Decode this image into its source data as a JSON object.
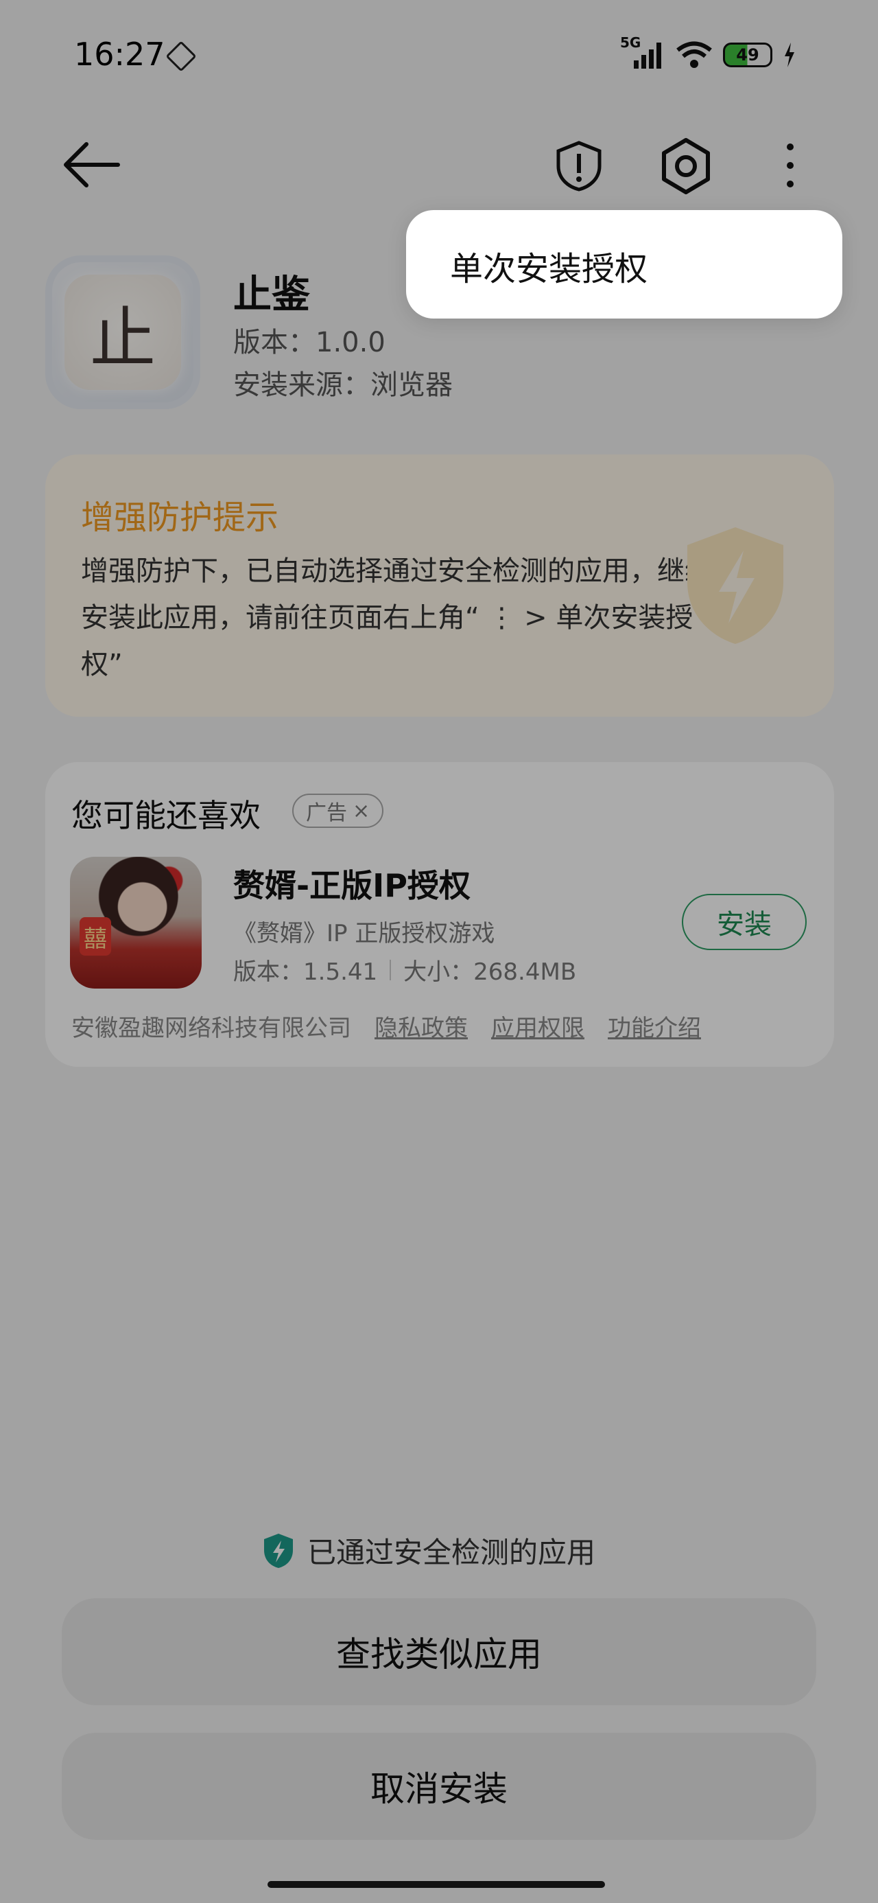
{
  "status_bar": {
    "time": "16:27",
    "network": "5G",
    "battery": "49"
  },
  "app": {
    "icon_char": "止",
    "name": "止鉴",
    "version": "版本：1.0.0",
    "source": "安装来源：浏览器"
  },
  "protection": {
    "title": "增强防护提示",
    "body": "增强防护下，已自动选择通过安全检测的应用，继续安装此应用，请前往页面右上角“ ⋮ > 单次安装授权”"
  },
  "recommend": {
    "title": "您可能还喜欢",
    "ad_label": "广告",
    "ad_close": "×",
    "app_name": "赘婿-正版IP授权",
    "app_desc": "《赘婿》IP 正版授权游戏",
    "version": "版本：1.5.41",
    "size": "大小：268.4MB",
    "install": "安装",
    "icon_badge": "囍",
    "developer": "安徽盈趣网络科技有限公司",
    "links": [
      "隐私政策",
      "应用权限",
      "功能介绍"
    ]
  },
  "bottom": {
    "verified_text": "已通过安全检测的应用",
    "find_similar": "查找类似应用",
    "cancel_install": "取消安装"
  },
  "menu": {
    "single_install_auth": "单次安装授权"
  },
  "colors": {
    "accent_orange": "#f09a22",
    "install_green": "#1f8a53",
    "verified_teal": "#1d9a8a"
  }
}
